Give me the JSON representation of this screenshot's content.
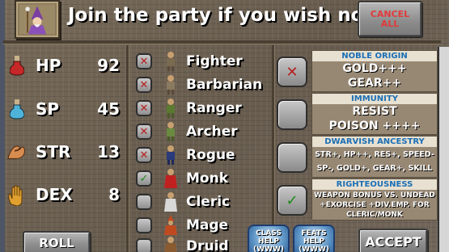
{
  "header": {
    "title": "Join the party if you wish now",
    "cancel_line1": "CANCEL",
    "cancel_line2": "ALL",
    "portrait_icon": "wizard-portrait-icon"
  },
  "stats": [
    {
      "label": "HP",
      "value": "92",
      "icon": "red-potion-icon",
      "color": "#c62828"
    },
    {
      "label": "SP",
      "value": "45",
      "icon": "blue-potion-icon",
      "color": "#4fb3d9"
    },
    {
      "label": "STR",
      "value": "13",
      "icon": "flexed-arm-icon",
      "color": "#d98c4f"
    },
    {
      "label": "DEX",
      "value": "8",
      "icon": "hand-icon",
      "color": "#e0a030"
    }
  ],
  "classes": [
    {
      "name": "Fighter",
      "state": "x",
      "mark": "✕"
    },
    {
      "name": "Barbarian",
      "state": "x",
      "mark": "✕"
    },
    {
      "name": "Ranger",
      "state": "x",
      "mark": "✕"
    },
    {
      "name": "Archer",
      "state": "x",
      "mark": "✕"
    },
    {
      "name": "Rogue",
      "state": "x",
      "mark": "✕"
    },
    {
      "name": "Monk",
      "state": "ok",
      "mark": "✓"
    },
    {
      "name": "Cleric",
      "state": "empty",
      "mark": ""
    },
    {
      "name": "Mage",
      "state": "empty",
      "mark": ""
    },
    {
      "name": "Druid",
      "state": "empty",
      "mark": ""
    }
  ],
  "traits": [
    {
      "title": "NOBLE ORIGIN",
      "lines": [
        "GOLD+++",
        "GEAR++"
      ],
      "state": "x",
      "mark": "✕"
    },
    {
      "title": "IMMUNITY",
      "lines": [
        "RESIST",
        "POISON ++++"
      ],
      "state": "empty",
      "mark": ""
    },
    {
      "title": "DWARVISH ANCESTRY",
      "lines": [
        "STR+, HP++, RES+, SPEED-",
        "SP-, GOLD+, GEAR+, SKILL"
      ],
      "state": "empty",
      "mark": ""
    },
    {
      "title": "RIGHTEOUSNESS",
      "lines": [
        "WEAPON BONUS VS. UNDEAD",
        "+EXORCISE +DIV.EMP. FOR",
        "CLERIC/MONK"
      ],
      "state": "ok",
      "mark": "✓"
    }
  ],
  "footer": {
    "roll": "ROLL",
    "class_help_1": "CLASS",
    "class_help_2": "HELP",
    "class_help_3": "(WWW)",
    "feats_help_1": "FEATS",
    "feats_help_2": "HELP",
    "feats_help_3": "(WWW)",
    "accept": "ACCEPT"
  }
}
